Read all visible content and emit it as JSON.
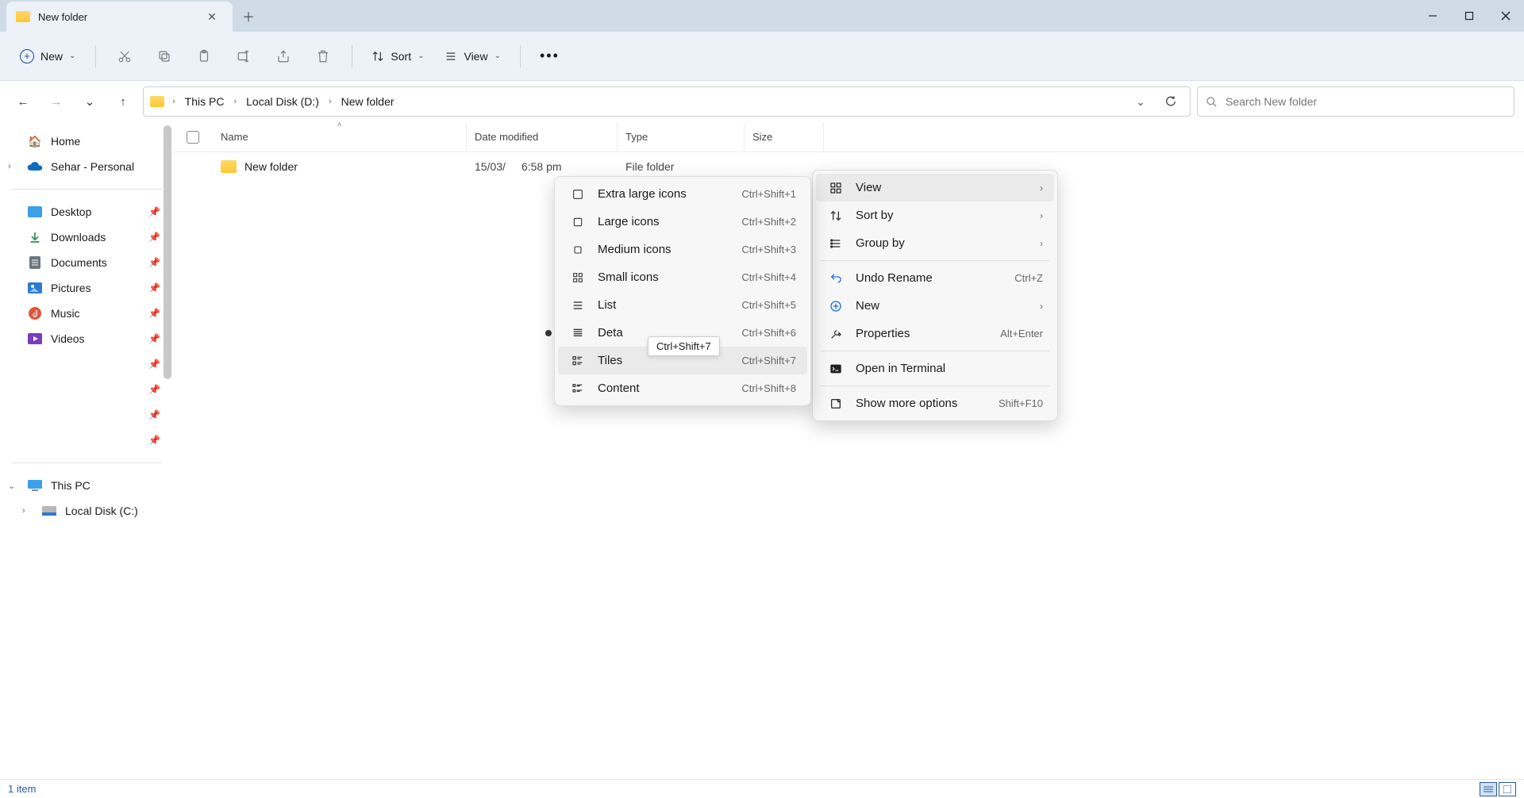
{
  "tab": {
    "title": "New folder"
  },
  "toolbar": {
    "new": "New",
    "sort": "Sort",
    "view": "View"
  },
  "breadcrumb": [
    "This PC",
    "Local Disk (D:)",
    "New folder"
  ],
  "search": {
    "placeholder": "Search New folder"
  },
  "sidebar": {
    "home": "Home",
    "personal": "Sehar - Personal",
    "desktop": "Desktop",
    "downloads": "Downloads",
    "documents": "Documents",
    "pictures": "Pictures",
    "music": "Music",
    "videos": "Videos",
    "thispc": "This PC",
    "localc": "Local Disk (C:)"
  },
  "columns": {
    "name": "Name",
    "date": "Date modified",
    "type": "Type",
    "size": "Size"
  },
  "rows": [
    {
      "name": "New folder",
      "date1": "15/03/",
      "date2": "6:58 pm",
      "type": "File folder",
      "size": ""
    }
  ],
  "context_main": {
    "view": "View",
    "sortby": "Sort by",
    "groupby": "Group by",
    "undo": "Undo Rename",
    "undo_short": "Ctrl+Z",
    "new": "New",
    "properties": "Properties",
    "properties_short": "Alt+Enter",
    "terminal": "Open in Terminal",
    "more": "Show more options",
    "more_short": "Shift+F10"
  },
  "context_view": [
    {
      "label": "Extra large icons",
      "short": "Ctrl+Shift+1"
    },
    {
      "label": "Large icons",
      "short": "Ctrl+Shift+2"
    },
    {
      "label": "Medium icons",
      "short": "Ctrl+Shift+3"
    },
    {
      "label": "Small icons",
      "short": "Ctrl+Shift+4"
    },
    {
      "label": "List",
      "short": "Ctrl+Shift+5"
    },
    {
      "label": "Deta",
      "short": "Ctrl+Shift+6",
      "selected": true
    },
    {
      "label": "Tiles",
      "short": "Ctrl+Shift+7",
      "hover": true
    },
    {
      "label": "Content",
      "short": "Ctrl+Shift+8"
    }
  ],
  "tooltip": "Ctrl+Shift+7",
  "status": {
    "count": "1 item"
  }
}
